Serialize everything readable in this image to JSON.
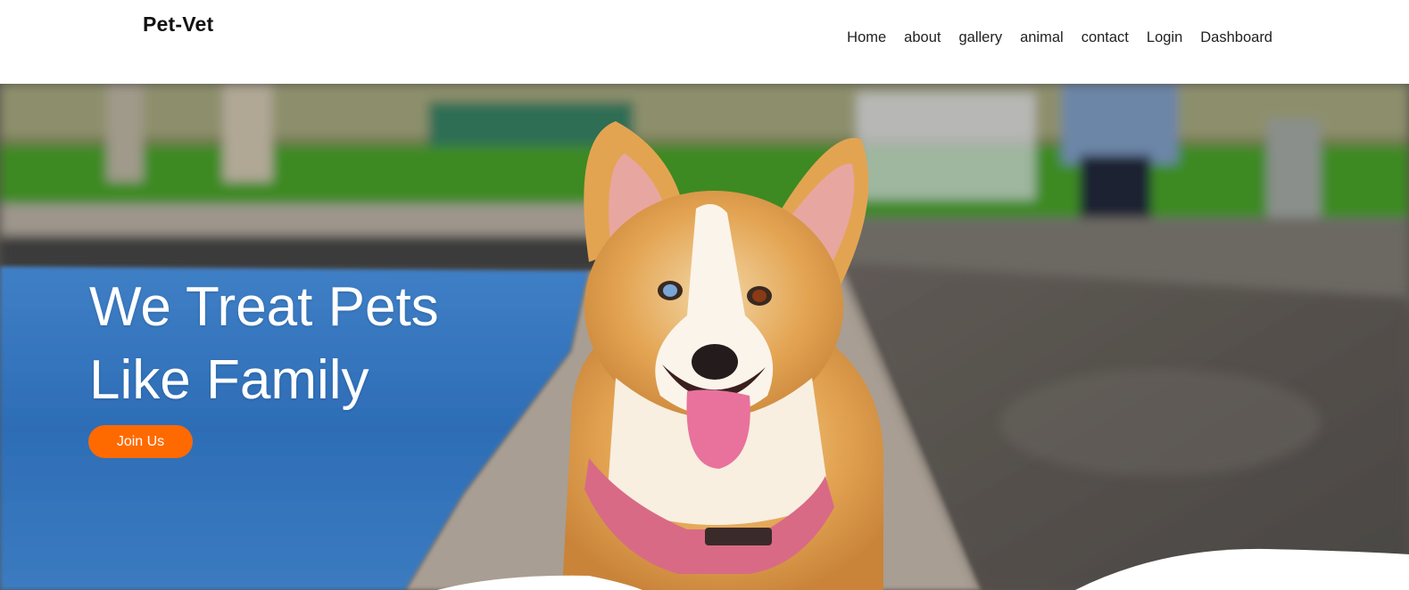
{
  "header": {
    "brand": "Pet-Vet",
    "nav": [
      "Home",
      "about",
      "gallery",
      "animal",
      "contact",
      "Login",
      "Dashboard"
    ]
  },
  "hero": {
    "headline_line1": "We Treat Pets",
    "headline_line2": "Like Family",
    "cta_label": "Join Us",
    "image": "corgi-dog-photo"
  },
  "colors": {
    "accent": "#ff6a00",
    "header_bg": "#ffffff",
    "hero_text": "#ffffff"
  }
}
